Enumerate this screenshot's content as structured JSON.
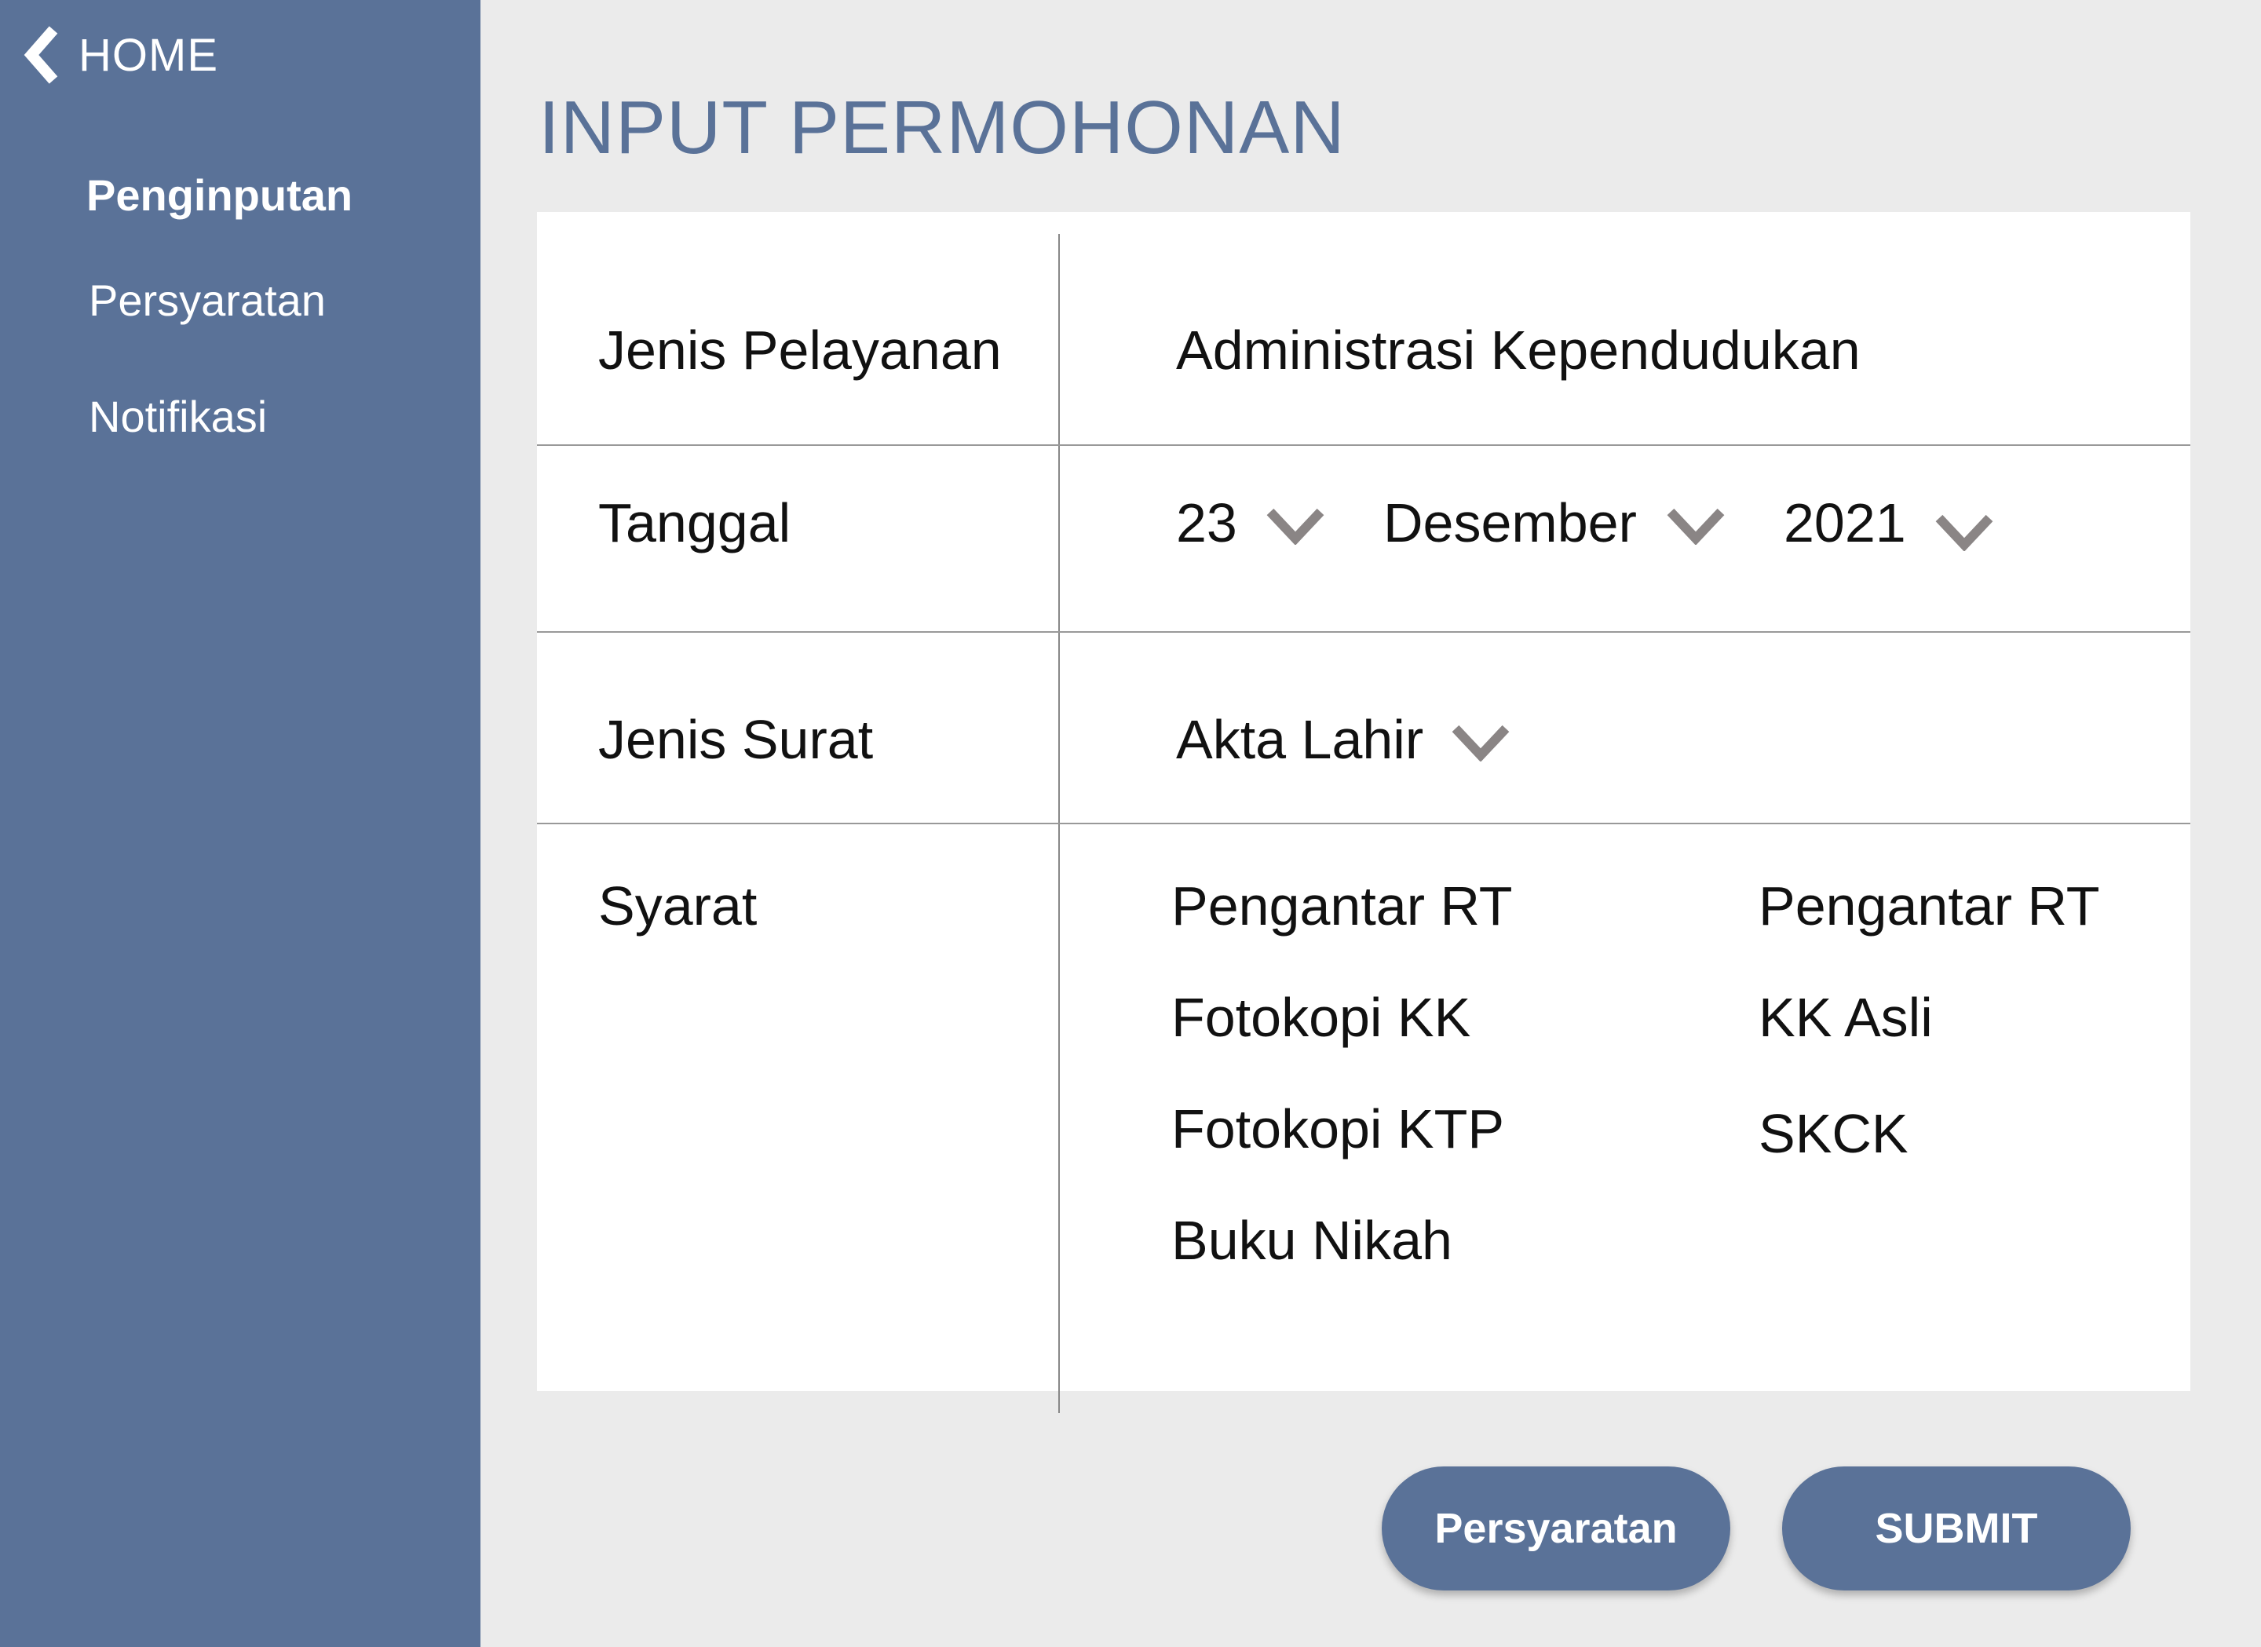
{
  "sidebar": {
    "home_label": "HOME",
    "items": [
      {
        "label": "Penginputan",
        "active": true
      },
      {
        "label": "Persyaratan",
        "active": false
      },
      {
        "label": "Notifikasi",
        "active": false
      }
    ]
  },
  "page": {
    "title": "INPUT PERMOHONAN"
  },
  "form": {
    "jenis_pelayanan": {
      "label": "Jenis Pelayanan",
      "value": "Administrasi Kependudukan"
    },
    "tanggal": {
      "label": "Tanggal",
      "day": "23",
      "month": "Desember",
      "year": "2021"
    },
    "jenis_surat": {
      "label": "Jenis Surat",
      "value": "Akta Lahir"
    },
    "syarat": {
      "label": "Syarat",
      "col1": [
        "Pengantar RT",
        "Fotokopi KK",
        "Fotokopi KTP",
        "Buku Nikah"
      ],
      "col2": [
        "Pengantar RT",
        "KK Asli",
        "SKCK"
      ]
    }
  },
  "buttons": {
    "persyaratan": "Persyaratan",
    "submit": "SUBMIT"
  },
  "colors": {
    "accent": "#5a7298",
    "background": "#ebebeb",
    "chevron": "#8a8585"
  }
}
